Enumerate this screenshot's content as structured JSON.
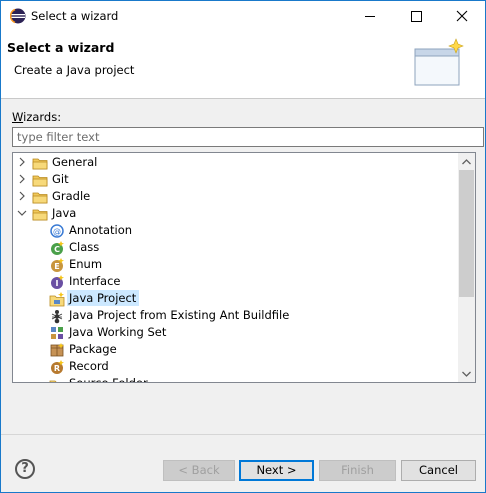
{
  "window": {
    "title": "Select a wizard"
  },
  "header": {
    "title": "Select a wizard",
    "description": "Create a Java project"
  },
  "wizards": {
    "label_prefix": "W",
    "label_rest": "izards:",
    "filter_placeholder": "type filter text"
  },
  "tree": {
    "items": [
      {
        "label": "General",
        "type": "folder",
        "expanded": false
      },
      {
        "label": "Git",
        "type": "folder",
        "expanded": false
      },
      {
        "label": "Gradle",
        "type": "folder",
        "expanded": false
      },
      {
        "label": "Java",
        "type": "folder",
        "expanded": true
      },
      {
        "label": "Annotation",
        "type": "annotation-icon"
      },
      {
        "label": "Class",
        "type": "class-icon"
      },
      {
        "label": "Enum",
        "type": "enum-icon"
      },
      {
        "label": "Interface",
        "type": "interface-icon"
      },
      {
        "label": "Java Project",
        "type": "java-project-icon",
        "selected": true
      },
      {
        "label": "Java Project from Existing Ant Buildfile",
        "type": "ant-icon"
      },
      {
        "label": "Java Working Set",
        "type": "working-set-icon"
      },
      {
        "label": "Package",
        "type": "package-icon"
      },
      {
        "label": "Record",
        "type": "record-icon"
      },
      {
        "label": "Source Folder",
        "type": "source-folder-icon"
      }
    ]
  },
  "buttons": {
    "back": "< Back",
    "next": "Next >",
    "finish": "Finish",
    "cancel": "Cancel",
    "help": "?"
  },
  "colors": {
    "accent": "#0078d7",
    "selection": "#cce8ff",
    "folder": "#e8b94a"
  }
}
